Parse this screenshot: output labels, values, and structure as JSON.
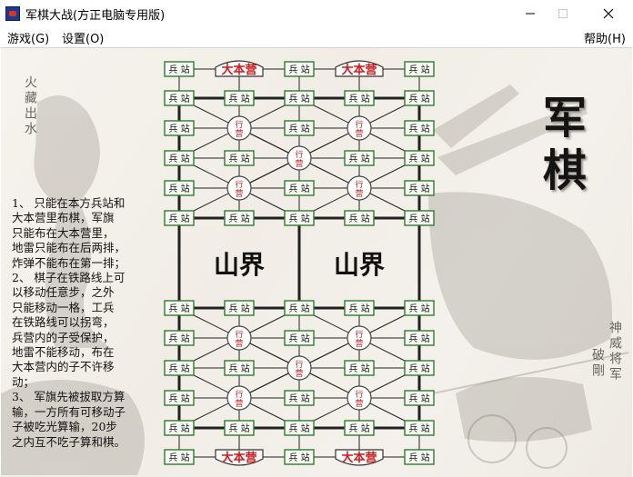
{
  "window": {
    "title": "军棋大战(方正电脑专用版)"
  },
  "menu": {
    "game": "游戏(G)",
    "settings": "设置(O)",
    "help": "帮助(H)"
  },
  "board": {
    "river_labels": [
      "山界",
      "山界"
    ],
    "post_label": "兵 站",
    "hq_label": "大本营",
    "camp_label": "行营",
    "top_half": [
      [
        "post",
        "hq",
        "post",
        "hq",
        "post"
      ],
      [
        "post",
        "post",
        "post",
        "post",
        "post"
      ],
      [
        "post",
        "camp",
        "post",
        "camp",
        "post"
      ],
      [
        "post",
        "post",
        "camp",
        "post",
        "post"
      ],
      [
        "post",
        "camp",
        "post",
        "camp",
        "post"
      ],
      [
        "post",
        "post",
        "post",
        "post",
        "post"
      ]
    ],
    "bottom_half": [
      [
        "post",
        "post",
        "post",
        "post",
        "post"
      ],
      [
        "post",
        "camp",
        "post",
        "camp",
        "post"
      ],
      [
        "post",
        "post",
        "camp",
        "post",
        "post"
      ],
      [
        "post",
        "camp",
        "post",
        "camp",
        "post"
      ],
      [
        "post",
        "post",
        "post",
        "post",
        "post"
      ],
      [
        "post",
        "hq",
        "post",
        "hq",
        "post"
      ]
    ]
  },
  "side_title": [
    "军",
    "棋"
  ],
  "poem_left": "火藏出水",
  "poem_right": [
    "神威将军",
    "破剛"
  ],
  "rules": [
    "1、 只能在本方兵站和",
    "大本营里布棋，军旗",
    "只能布在大本营里，",
    "地雷只能布在后两排，",
    "炸弹不能布在第一排；",
    "2、 棋子在铁路线上可",
    "以移动任意步，之外",
    "只能移动一格，工兵",
    "在铁路线可以拐弯，",
    "兵营内的子受保护，",
    "地雷不能移动，布在",
    "大本营内的子不许移",
    "动；",
    "3、 军旗先被拔取方算",
    "输，一方所有可移动子",
    "子被吃光算输，20步",
    "之内互不吃子算和棋。"
  ],
  "colors": {
    "post_border": "#2e7d2e",
    "red_text": "#d01a1a",
    "rail": "#222222"
  }
}
